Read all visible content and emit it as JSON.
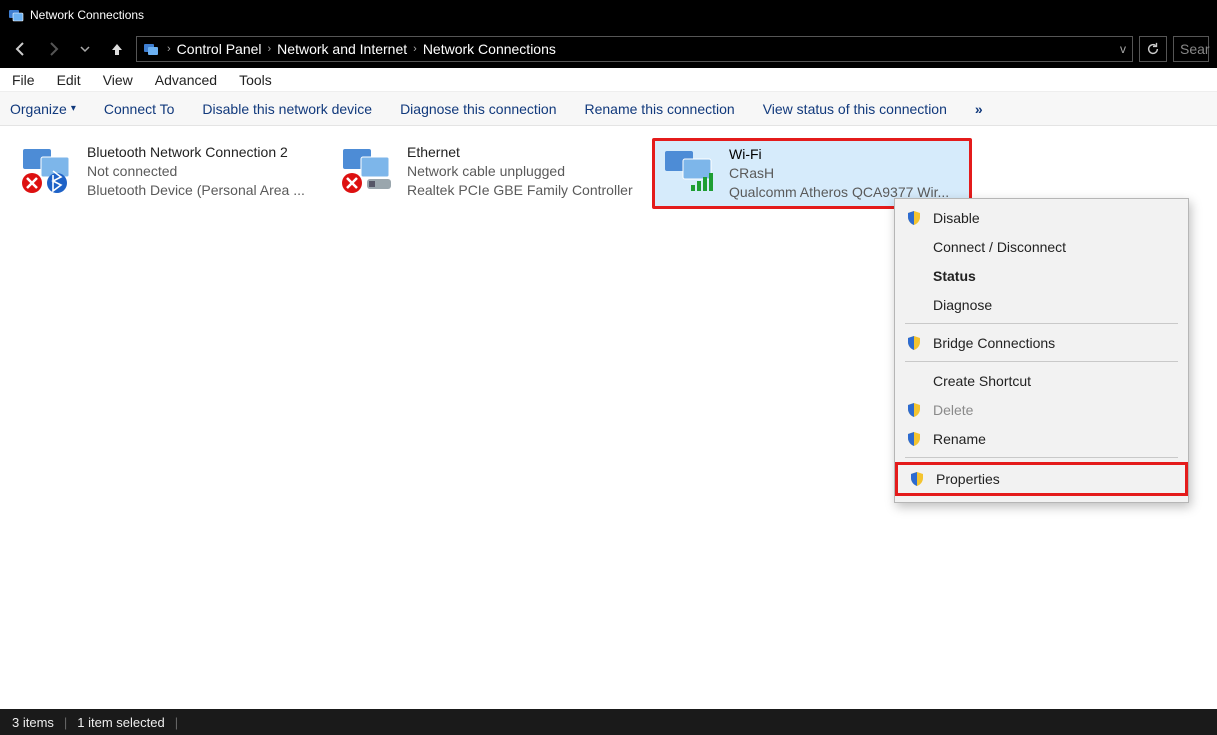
{
  "title": "Network Connections",
  "breadcrumb": [
    "Control Panel",
    "Network and Internet",
    "Network Connections"
  ],
  "search_placeholder": "Sear",
  "menu": {
    "file": "File",
    "edit": "Edit",
    "view": "View",
    "advanced": "Advanced",
    "tools": "Tools"
  },
  "cmdbar": {
    "organize": "Organize",
    "connect_to": "Connect To",
    "disable": "Disable this network device",
    "diagnose": "Diagnose this connection",
    "rename": "Rename this connection",
    "viewstatus": "View status of this connection",
    "more": "»"
  },
  "connections": [
    {
      "name": "Bluetooth Network Connection 2",
      "status": "Not connected",
      "device": "Bluetooth Device (Personal Area ..."
    },
    {
      "name": "Ethernet",
      "status": "Network cable unplugged",
      "device": "Realtek PCIe GBE Family Controller"
    },
    {
      "name": "Wi-Fi",
      "status": "CRasH",
      "device": "Qualcomm Atheros QCA9377 Wir..."
    }
  ],
  "context_menu": {
    "disable": "Disable",
    "connect": "Connect / Disconnect",
    "status": "Status",
    "diagnose": "Diagnose",
    "bridge": "Bridge Connections",
    "shortcut": "Create Shortcut",
    "delete": "Delete",
    "rename": "Rename",
    "properties": "Properties"
  },
  "status": {
    "count": "3 items",
    "selected": "1 item selected"
  }
}
